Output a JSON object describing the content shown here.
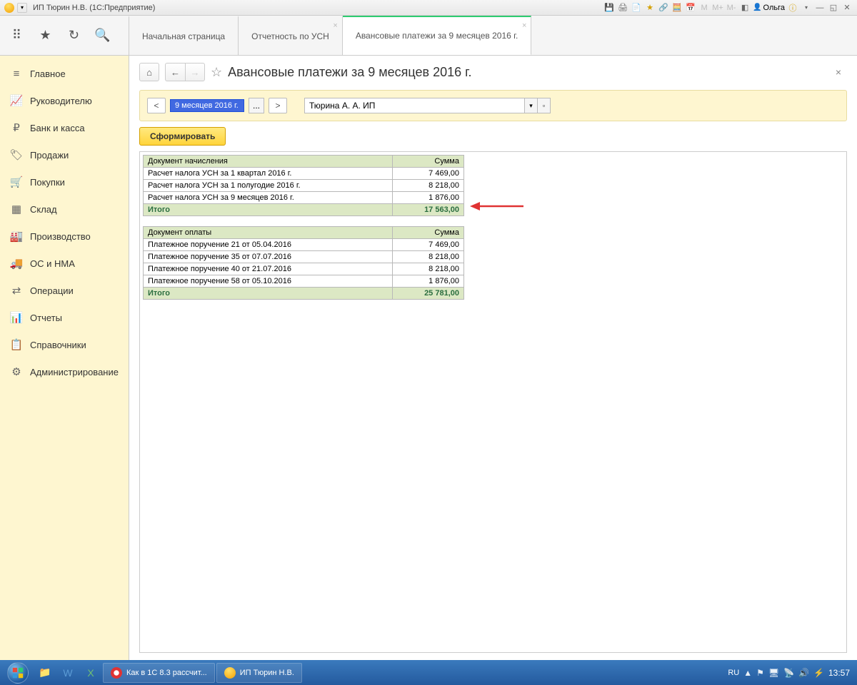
{
  "titlebar": {
    "app_title": "ИП Тюрин Н.В.  (1С:Предприятие)",
    "user_name": "Ольга",
    "m_labels": [
      "M",
      "M+",
      "M-"
    ]
  },
  "tabs": {
    "items": [
      "Начальная страница",
      "Отчетность по УСН",
      "Авансовые платежи за 9 месяцев 2016 г."
    ],
    "active_index": 2
  },
  "sidebar": {
    "items": [
      {
        "icon": "≡",
        "label": "Главное"
      },
      {
        "icon": "📈",
        "label": "Руководителю"
      },
      {
        "icon": "₽",
        "label": "Банк и касса"
      },
      {
        "icon": "🏷",
        "label": "Продажи"
      },
      {
        "icon": "🛒",
        "label": "Покупки"
      },
      {
        "icon": "▦",
        "label": "Склад"
      },
      {
        "icon": "🏭",
        "label": "Производство"
      },
      {
        "icon": "🚚",
        "label": "ОС и НМА"
      },
      {
        "icon": "⇄",
        "label": "Операции"
      },
      {
        "icon": "📊",
        "label": "Отчеты"
      },
      {
        "icon": "📋",
        "label": "Справочники"
      },
      {
        "icon": "⚙",
        "label": "Администрирование"
      }
    ]
  },
  "page": {
    "title": "Авансовые платежи за 9 месяцев 2016 г.",
    "period_value": "9 месяцев 2016 г.",
    "org_value": "Тюрина А. А. ИП",
    "generate_label": "Сформировать",
    "dots": "..."
  },
  "table1": {
    "header_doc": "Документ начисления",
    "header_sum": "Сумма",
    "rows": [
      {
        "doc": "Расчет налога УСН  за 1 квартал 2016 г.",
        "sum": "7 469,00"
      },
      {
        "doc": "Расчет налога УСН  за 1 полугодие 2016 г.",
        "sum": "8 218,00"
      },
      {
        "doc": "Расчет налога УСН  за 9 месяцев 2016 г.",
        "sum": "1 876,00"
      }
    ],
    "total_label": "Итого",
    "total_sum": "17 563,00"
  },
  "table2": {
    "header_doc": "Документ оплаты",
    "header_sum": "Сумма",
    "rows": [
      {
        "doc": "Платежное поручение 21 от 05.04.2016",
        "sum": "7 469,00"
      },
      {
        "doc": "Платежное поручение 35 от 07.07.2016",
        "sum": "8 218,00"
      },
      {
        "doc": "Платежное поручение 40 от 21.07.2016",
        "sum": "8 218,00"
      },
      {
        "doc": "Платежное поручение 58 от 05.10.2016",
        "sum": "1 876,00"
      }
    ],
    "total_label": "Итого",
    "total_sum": "25 781,00"
  },
  "taskbar": {
    "task1": "Как в 1С 8.3 рассчит...",
    "task2": "ИП Тюрин Н.В.",
    "lang": "RU",
    "time": "13:57"
  }
}
